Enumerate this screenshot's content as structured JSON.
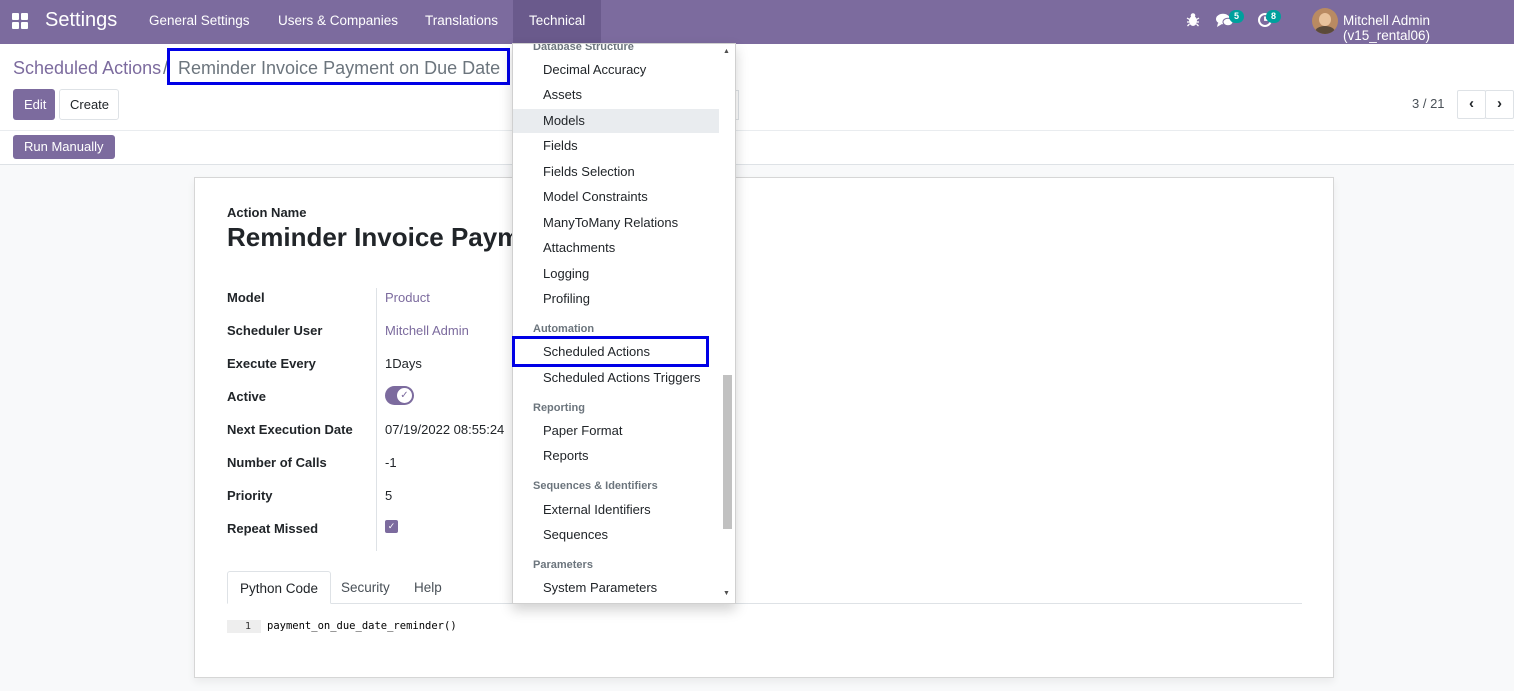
{
  "navbar": {
    "brand": "Settings",
    "menu": [
      "General Settings",
      "Users & Companies",
      "Translations",
      "Technical"
    ],
    "icons": [
      "apps-grid-icon",
      "bug-icon",
      "chat-icon",
      "activity-clock-icon"
    ],
    "messages_count": "5",
    "activities_count": "8",
    "user": "Mitchell Admin (v15_rental06)"
  },
  "breadcrumb": {
    "parent": "Scheduled Actions",
    "separator": "/",
    "current": "Reminder Invoice Payment on Due Date"
  },
  "buttons": {
    "edit": "Edit",
    "create": "Create",
    "run_manually": "Run Manually"
  },
  "pager": {
    "value": "3 / 21",
    "prev": "‹",
    "next": "›"
  },
  "form": {
    "name_label": "Action Name",
    "name_value": "Reminder Invoice Paym",
    "fields": [
      {
        "label": "Model",
        "value": "Product"
      },
      {
        "label": "Scheduler User",
        "value": "Mitchell Admin"
      },
      {
        "label": "Execute Every",
        "value": "1Days"
      },
      {
        "label": "Active",
        "value": ""
      },
      {
        "label": "Next Execution Date",
        "value": "07/19/2022 08:55:24"
      },
      {
        "label": "Number of Calls",
        "value": "-1"
      },
      {
        "label": "Priority",
        "value": "5"
      },
      {
        "label": "Repeat Missed",
        "value": ""
      }
    ],
    "active": true,
    "repeat_missed": true,
    "tabs": [
      "Python Code",
      "Security",
      "Help"
    ],
    "code_line_number": "1",
    "code": "payment_on_due_date_reminder()"
  },
  "dropdown": {
    "section_database": "Database Structure",
    "database_items": [
      "Decimal Accuracy",
      "Assets",
      "Models",
      "Fields",
      "Fields Selection",
      "Model Constraints",
      "ManyToMany Relations",
      "Attachments",
      "Logging",
      "Profiling"
    ],
    "section_automation": "Automation",
    "automation_items": [
      "Scheduled Actions",
      "Scheduled Actions Triggers"
    ],
    "section_reporting": "Reporting",
    "reporting_items": [
      "Paper Format",
      "Reports"
    ],
    "section_sequences": "Sequences & Identifiers",
    "sequences_items": [
      "External Identifiers",
      "Sequences"
    ],
    "section_parameters": "Parameters",
    "parameters_items": [
      "System Parameters"
    ]
  },
  "colors": {
    "brand": "#7c6b9e",
    "highlight": "#0000e6",
    "badge": "#00a09d"
  }
}
